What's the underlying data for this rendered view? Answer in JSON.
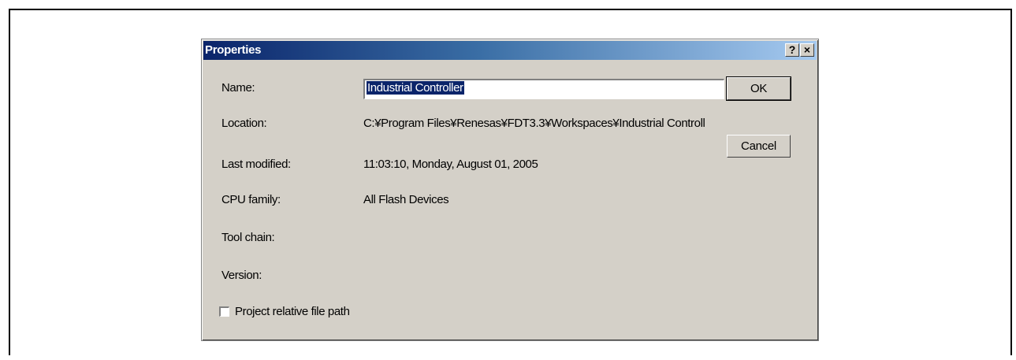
{
  "window": {
    "title": "Properties",
    "help_label": "?",
    "close_label": "×"
  },
  "fields": {
    "name_label": "Name:",
    "name_value": "Industrial Controller",
    "location_label": "Location:",
    "location_value": "C:¥Program Files¥Renesas¥FDT3.3¥Workspaces¥Industrial Controll",
    "last_modified_label": "Last modified:",
    "last_modified_value": "11:03:10, Monday, August 01, 2005",
    "cpu_family_label": "CPU family:",
    "cpu_family_value": "All Flash Devices",
    "tool_chain_label": "Tool chain:",
    "version_label": "Version:"
  },
  "options": {
    "project_relative_label": "Project relative file path",
    "project_relative_checked": false
  },
  "buttons": {
    "ok_label": "OK",
    "cancel_label": "Cancel"
  }
}
